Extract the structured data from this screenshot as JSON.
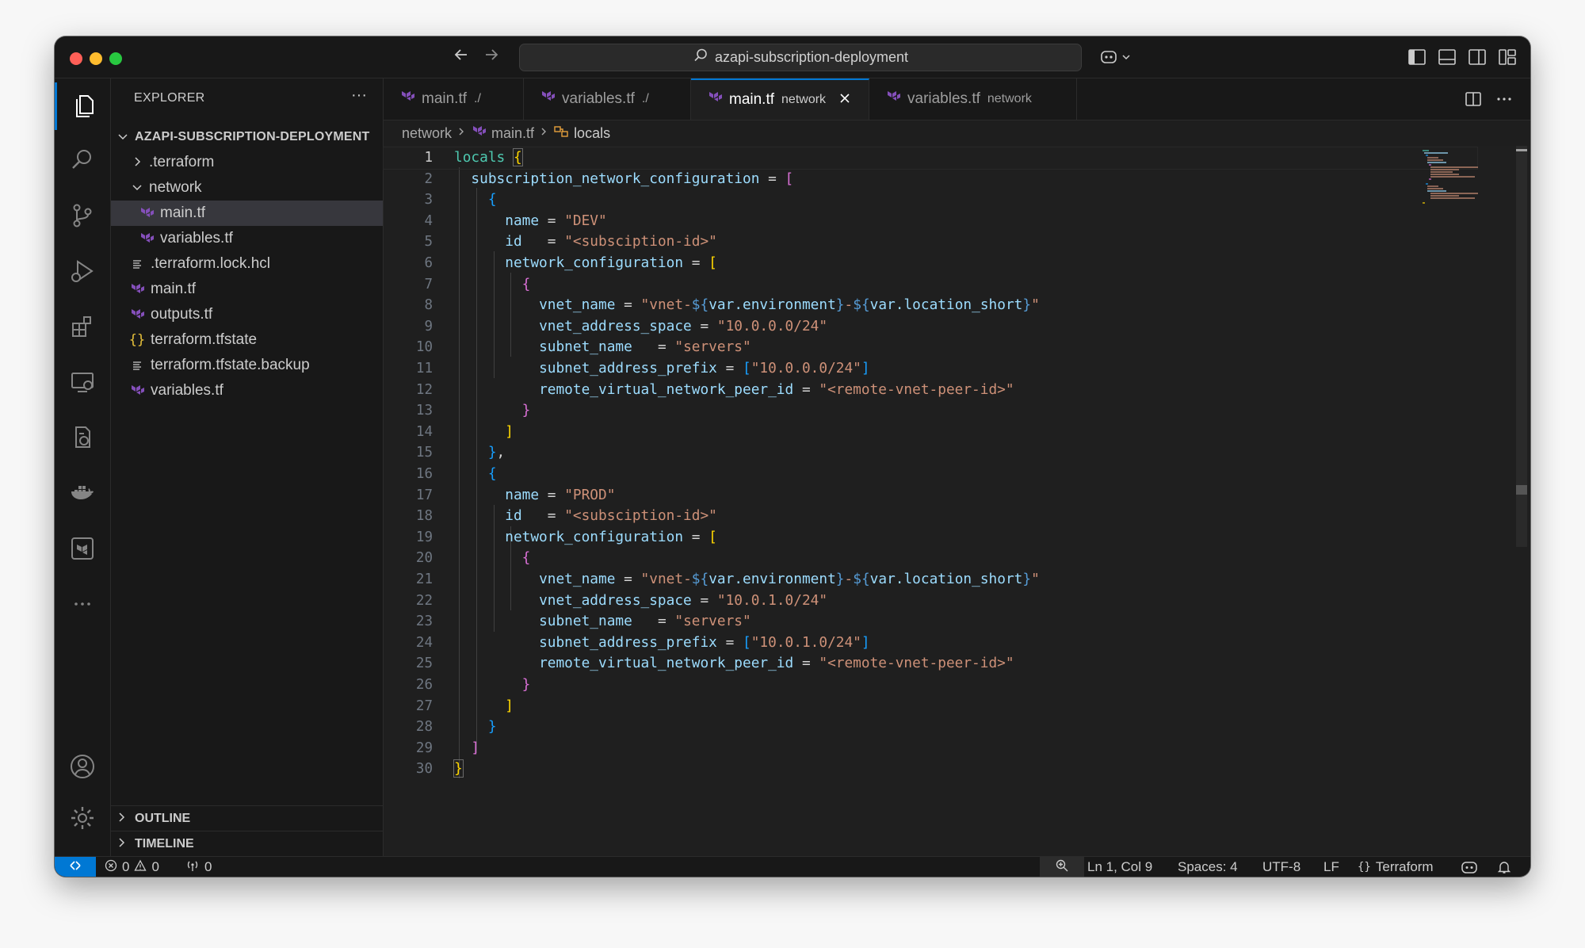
{
  "window": {
    "command_center": "azapi-subscription-deployment"
  },
  "sidebar": {
    "title": "EXPLORER",
    "more": "···",
    "root": "AZAPI-SUBSCRIPTION-DEPLOYMENT",
    "tree": [
      {
        "label": ".terraform",
        "kind": "folder",
        "expanded": false
      },
      {
        "label": "network",
        "kind": "folder",
        "expanded": true
      },
      {
        "label": "main.tf",
        "kind": "terraform",
        "selected": true
      },
      {
        "label": "variables.tf",
        "kind": "terraform"
      },
      {
        "label": ".terraform.lock.hcl",
        "kind": "lines"
      },
      {
        "label": "main.tf",
        "kind": "terraform"
      },
      {
        "label": "outputs.tf",
        "kind": "terraform"
      },
      {
        "label": "terraform.tfstate",
        "kind": "json"
      },
      {
        "label": "terraform.tfstate.backup",
        "kind": "lines"
      },
      {
        "label": "variables.tf",
        "kind": "terraform"
      }
    ],
    "sections": [
      "OUTLINE",
      "TIMELINE"
    ]
  },
  "tabs": [
    {
      "label": "main.tf",
      "desc": "./"
    },
    {
      "label": "variables.tf",
      "desc": "./"
    },
    {
      "label": "main.tf",
      "desc": "network",
      "active": true
    },
    {
      "label": "variables.tf",
      "desc": "network"
    }
  ],
  "breadcrumb": {
    "folder": "network",
    "file": "main.tf",
    "symbol": "locals"
  },
  "editor": {
    "line_numbers": [
      "1",
      "2",
      "3",
      "4",
      "5",
      "6",
      "7",
      "8",
      "9",
      "10",
      "11",
      "12",
      "13",
      "14",
      "15",
      "16",
      "17",
      "18",
      "19",
      "20",
      "21",
      "22",
      "23",
      "24",
      "25",
      "26",
      "27",
      "28",
      "29",
      "30"
    ]
  },
  "statusbar": {
    "errors": "0",
    "warnings": "0",
    "ports": "0",
    "position": "Ln 1, Col 9",
    "spaces": "Spaces: 4",
    "encoding": "UTF-8",
    "eol": "LF",
    "language": "Terraform"
  },
  "colors": {
    "accent": "#0078d4",
    "terraform_icon": "#844fba",
    "editor_bg": "#1f1f1f",
    "string": "#ce9178",
    "property": "#9cdcfe",
    "keyword": "#4ec9b0"
  }
}
